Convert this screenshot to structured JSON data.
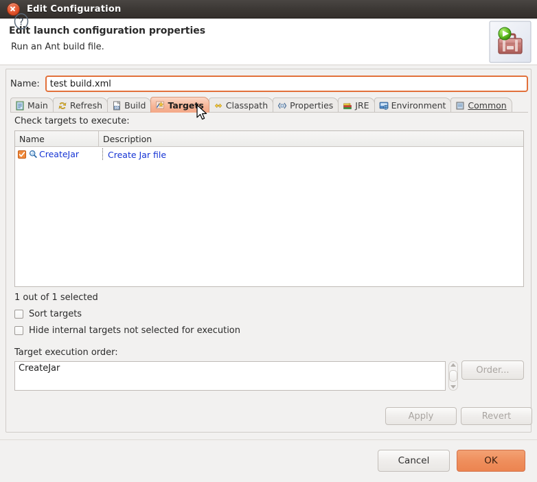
{
  "window": {
    "title": "Edit Configuration",
    "close_icon": "close-icon"
  },
  "header": {
    "title": "Edit launch configuration properties",
    "subtitle": "Run an Ant build file.",
    "icon": "ant-build-toolbox-icon"
  },
  "name_field": {
    "label": "Name:",
    "value": "test build.xml"
  },
  "tabs": [
    {
      "label": "Main",
      "icon": "document-icon",
      "active": false
    },
    {
      "label": "Refresh",
      "icon": "refresh-icon",
      "active": false
    },
    {
      "label": "Build",
      "icon": "build-binary-icon",
      "active": false
    },
    {
      "label": "Targets",
      "icon": "targets-icon",
      "active": true
    },
    {
      "label": "Classpath",
      "icon": "classpath-icon",
      "active": false
    },
    {
      "label": "Properties",
      "icon": "properties-icon",
      "active": false
    },
    {
      "label": "JRE",
      "icon": "jre-books-icon",
      "active": false
    },
    {
      "label": "Environment",
      "icon": "environment-icon",
      "active": false
    },
    {
      "label": "Common",
      "icon": "common-icon",
      "active": false
    }
  ],
  "targets_panel": {
    "instruction": "Check targets to execute:",
    "columns": [
      "Name",
      "Description"
    ],
    "rows": [
      {
        "checked": true,
        "icon": "target-search-icon",
        "name": "CreateJar",
        "description": "Create Jar file"
      }
    ],
    "selection_status": "1 out of 1 selected",
    "options": [
      {
        "label": "Sort targets",
        "checked": false
      },
      {
        "label": "Hide internal targets not selected for execution",
        "checked": false
      }
    ],
    "order_label": "Target execution order:",
    "order_value": "CreateJar",
    "order_button": "Order...",
    "scrollbar": "vertical-scrollbar"
  },
  "action_buttons": {
    "apply": "Apply",
    "revert": "Revert"
  },
  "footer": {
    "help_icon": "help-question-icon",
    "cancel": "Cancel",
    "ok": "OK"
  },
  "colors": {
    "accent_orange": "#e2703a",
    "ok_button": "#ef8f5d",
    "link_blue": "#1433d4",
    "titlebar": "#3c3835"
  },
  "cursor": {
    "icon": "mouse-pointer-arrow"
  }
}
